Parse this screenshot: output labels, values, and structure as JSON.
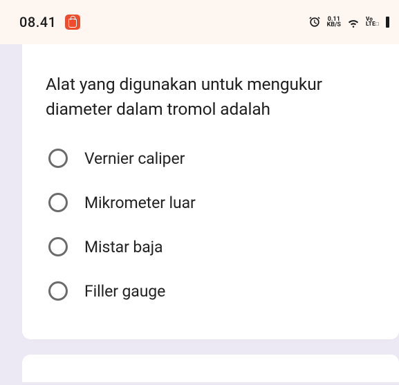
{
  "status_bar": {
    "time": "08.41",
    "net_speed_value": "0.11",
    "net_speed_unit": "KB/S",
    "volte_top": "Vo",
    "volte_bottom": "LTE□"
  },
  "question": " Alat yang digunakan untuk mengukur diameter dalam tromol adalah",
  "options": [
    {
      "label": "Vernier caliper"
    },
    {
      "label": "Mikrometer luar"
    },
    {
      "label": "Mistar baja"
    },
    {
      "label": "Filler gauge"
    }
  ]
}
